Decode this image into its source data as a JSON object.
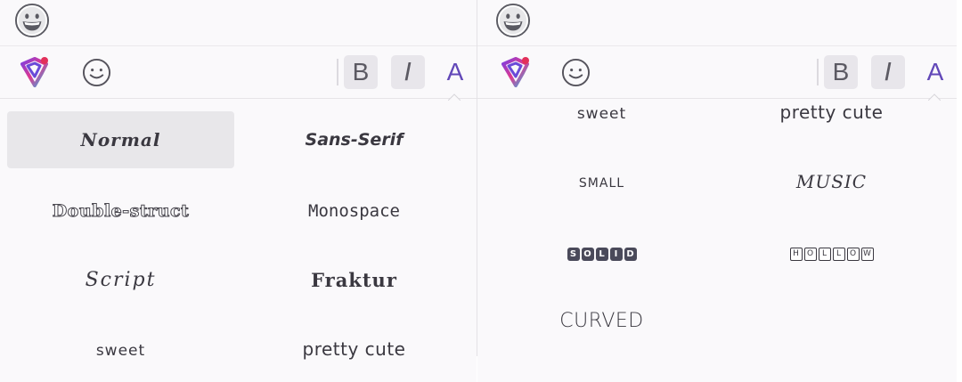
{
  "left_panel": {
    "format_buttons": {
      "bold": "B",
      "italic": "I",
      "font": "A"
    },
    "styles": [
      {
        "label": "Normal",
        "selected": true
      },
      {
        "label": "Sans-Serif"
      },
      {
        "label": "Double-struct"
      },
      {
        "label": "Monospace"
      },
      {
        "label": "Script"
      },
      {
        "label": "Fraktur"
      },
      {
        "label": "sweet"
      },
      {
        "label": "pretty cute"
      }
    ]
  },
  "right_panel": {
    "format_buttons": {
      "bold": "B",
      "italic": "I",
      "font": "A"
    },
    "styles": [
      {
        "label": "sweet"
      },
      {
        "label": "pretty cute"
      },
      {
        "label": "SMALL"
      },
      {
        "label": "MUSIC"
      },
      {
        "label": "CURVED"
      }
    ],
    "solid_letters": [
      "S",
      "O",
      "L",
      "I",
      "D"
    ],
    "hollow_letters": [
      "H",
      "O",
      "L",
      "L",
      "O",
      "W"
    ]
  },
  "colors": {
    "accent": "#6248b8",
    "selected_bg": "#e8e7ea",
    "button_bg": "#e8e6eb"
  },
  "icons": {
    "emoji": "smiley-icon",
    "logo": "app-logo-icon",
    "caret": "caret-up-icon"
  }
}
